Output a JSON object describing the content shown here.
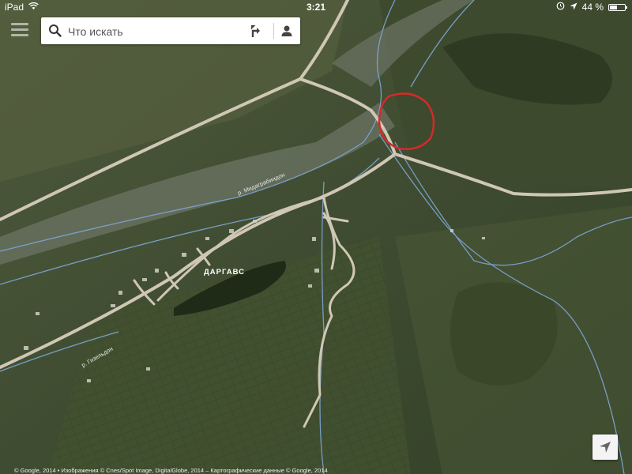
{
  "status_bar": {
    "device": "iPad",
    "time": "3:21",
    "battery": "44 %",
    "battery_level": 0.44
  },
  "search": {
    "placeholder": "Что искать"
  },
  "map": {
    "view": "satellite",
    "labels": {
      "village": "ДАРГАВС",
      "river_1": "р. Мидаграбиндон",
      "river_2": "р. Гизельдон"
    },
    "annotation_color": "#d42a2a"
  },
  "footer": {
    "copyright": "© Google, 2014 • Изображения © Cnes/Spot Image, DigitalGlobe, 2014 – Картографические данные © Google, 2014"
  },
  "icons": [
    "wifi-icon",
    "location-arrow-icon",
    "alarm-icon",
    "menu-icon",
    "search-icon",
    "directions-icon",
    "account-icon",
    "locate-icon"
  ]
}
